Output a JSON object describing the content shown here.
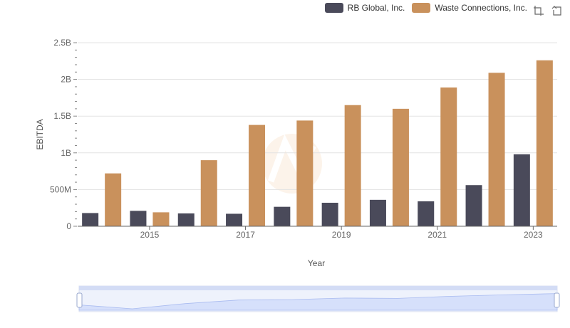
{
  "legend": [
    {
      "name": "RB Global, Inc.",
      "color": "#4a4a5a"
    },
    {
      "name": "Waste Connections, Inc.",
      "color": "#c9915c"
    }
  ],
  "toolbox": {
    "icons": [
      "data-zoom-icon",
      "restore-icon"
    ]
  },
  "chart_data": {
    "type": "bar",
    "x": [
      2014,
      2015,
      2016,
      2017,
      2018,
      2019,
      2020,
      2021,
      2022,
      2023
    ],
    "x_tick_labels": [
      "2015",
      "2017",
      "2019",
      "2021",
      "2023"
    ],
    "xlabel": "Year",
    "ylabel": "EBITDA",
    "ylim": [
      0,
      2500000000
    ],
    "y_tick_labels": [
      "0",
      "500M",
      "1B",
      "1.5B",
      "2B",
      "2.5B"
    ],
    "grid": true,
    "legend_position": "top-right",
    "series": [
      {
        "name": "RB Global, Inc.",
        "color": "#4a4a5a",
        "values": [
          180000000,
          210000000,
          175000000,
          170000000,
          265000000,
          320000000,
          360000000,
          340000000,
          560000000,
          980000000
        ]
      },
      {
        "name": "Waste Connections, Inc.",
        "color": "#c9915c",
        "values": [
          720000000,
          190000000,
          900000000,
          1380000000,
          1440000000,
          1650000000,
          1600000000,
          1890000000,
          2090000000,
          2260000000
        ]
      }
    ]
  },
  "data_zoom": {
    "start_percent": 0,
    "end_percent": 100
  }
}
